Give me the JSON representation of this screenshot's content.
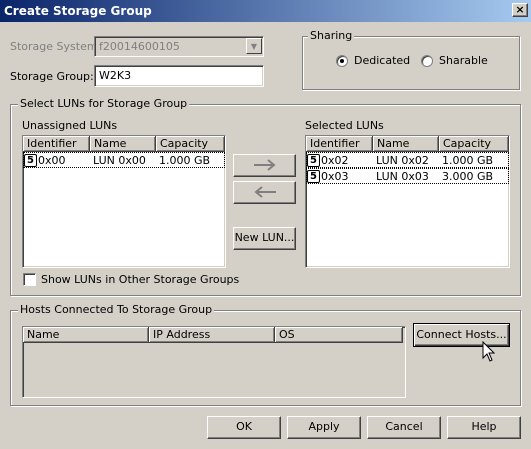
{
  "window": {
    "title": "Create Storage Group",
    "close_glyph": "×"
  },
  "form": {
    "storage_system_label": "Storage System:",
    "storage_system_value": "f20014600105",
    "storage_group_label": "Storage Group:",
    "storage_group_value": "W2K3"
  },
  "sharing": {
    "legend": "Sharing",
    "options": [
      {
        "label": "Dedicated",
        "selected": true
      },
      {
        "label": "Sharable",
        "selected": false
      }
    ]
  },
  "luns": {
    "legend": "Select LUNs for Storage Group",
    "unassigned_label": "Unassigned LUNs",
    "selected_label": "Selected LUNs",
    "columns": [
      "Identifier",
      "Name",
      "Capacity"
    ],
    "unassigned_rows": [
      {
        "identifier": "0x00",
        "name": "LUN 0x00",
        "capacity": "1.000 GB"
      }
    ],
    "selected_rows": [
      {
        "identifier": "0x02",
        "name": "LUN 0x02",
        "capacity": "1.000 GB"
      },
      {
        "identifier": "0x03",
        "name": "LUN 0x03",
        "capacity": "3.000 GB"
      }
    ],
    "icon_glyph": "5",
    "new_lun_label": "New LUN...",
    "show_other_label": "Show LUNs in Other Storage Groups"
  },
  "hosts": {
    "legend": "Hosts Connected To Storage Group",
    "columns": [
      "Name",
      "IP Address",
      "OS"
    ],
    "connect_label": "Connect Hosts..."
  },
  "footer": {
    "ok_label": "OK",
    "apply_label": "Apply",
    "cancel_label": "Cancel",
    "help_label": "Help"
  }
}
